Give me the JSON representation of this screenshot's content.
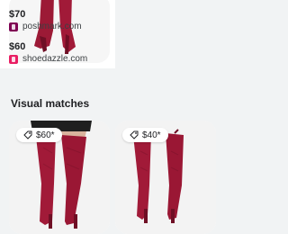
{
  "offers": [
    {
      "price": "$70",
      "store": "poshmark.com",
      "favicon": "poshmark-favicon",
      "accent": "#7f0353"
    },
    {
      "price": "$60",
      "store": "shoedazzle.com",
      "favicon": "shoedazzle-favicon",
      "accent": "#e91e63"
    }
  ],
  "visual_matches": {
    "title": "Visual matches",
    "items": [
      {
        "price": "$60*",
        "icon": "price-tag-icon",
        "image": "red over-the-knee boots on model"
      },
      {
        "price": "$40*",
        "icon": "price-tag-icon",
        "image": "red over-the-knee boots"
      }
    ]
  },
  "colors": {
    "boot": "#a11a38",
    "boot_dark": "#6f0f25",
    "background": "#f1f3f4"
  }
}
